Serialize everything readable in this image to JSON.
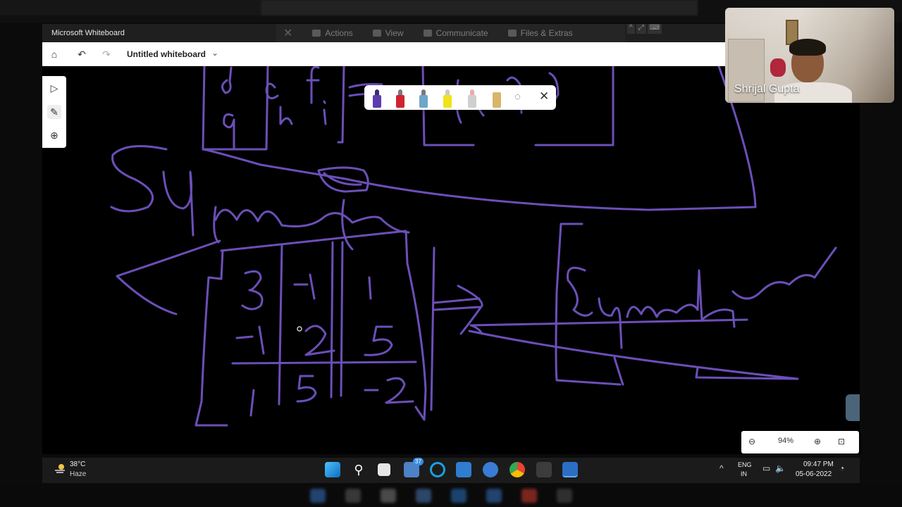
{
  "window": {
    "title": "Microsoft Whiteboard"
  },
  "share_toolbar": {
    "items": [
      "Actions",
      "View",
      "Communicate",
      "Files & Extras"
    ]
  },
  "appbar": {
    "doc_title": "Untitled whiteboard",
    "home_icon": "home-icon",
    "undo_icon": "undo-icon",
    "redo_icon": "redo-icon"
  },
  "toolrail": {
    "tools": [
      "select-icon",
      "pen-icon",
      "add-icon"
    ]
  },
  "pen_tray": {
    "pens": [
      {
        "name": "purple-pen",
        "color": "#5b3db0"
      },
      {
        "name": "red-pen",
        "color": "#d0232f"
      },
      {
        "name": "blue-pen",
        "color": "#6ea6c9"
      },
      {
        "name": "yellow-highlighter",
        "color": "#f1e21a"
      },
      {
        "name": "eraser",
        "color": "#f0a9a9"
      },
      {
        "name": "ruler",
        "color": "#d9b46b"
      }
    ]
  },
  "zoom": {
    "level": "94%"
  },
  "webcam": {
    "name": "Shrijal Gupta"
  },
  "taskbar": {
    "temperature": "38°C",
    "condition": "Haze",
    "teams_badge": "37",
    "lang_line1": "ENG",
    "lang_line2": "IN",
    "time": "09:47 PM",
    "date": "05-06-2022"
  },
  "colors": {
    "ink": "#6b4fb8",
    "canvas": "#000000"
  }
}
